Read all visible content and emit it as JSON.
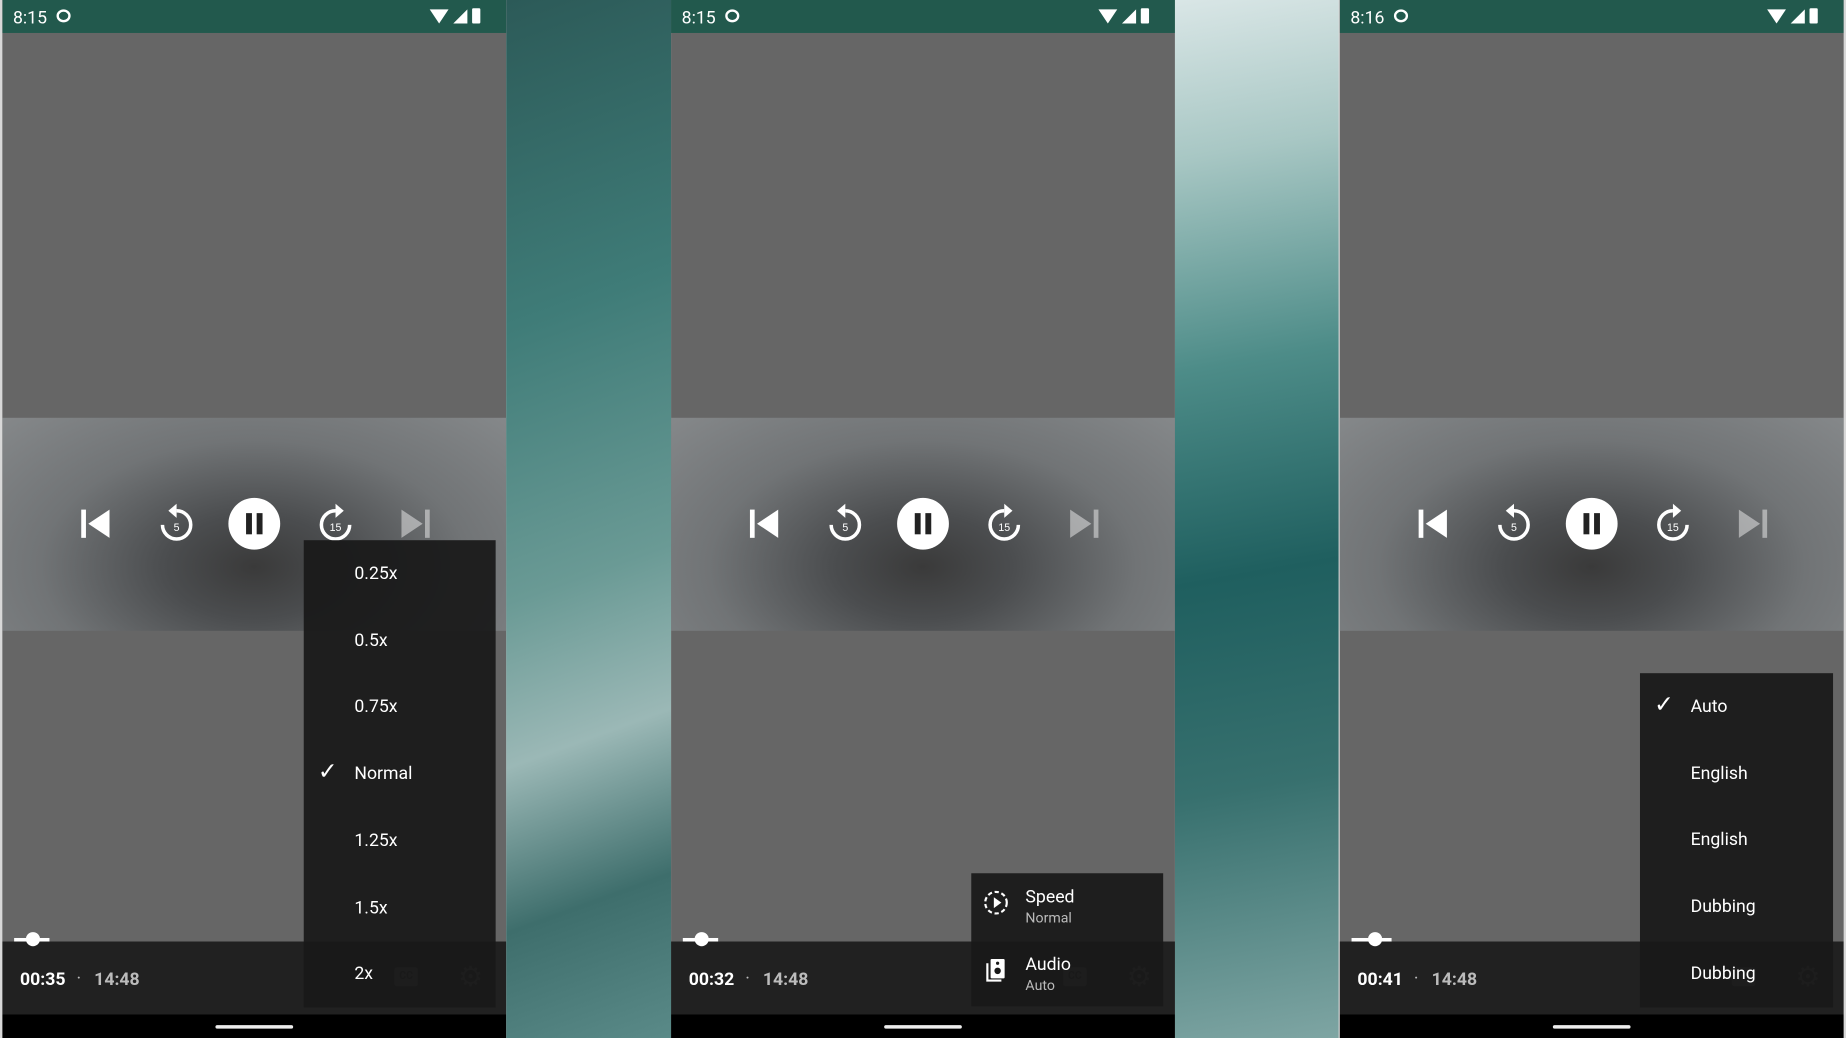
{
  "panels": [
    {
      "status_time": "8:15",
      "position": "00:35",
      "duration": "14:48",
      "progress_fraction": 0.04
    },
    {
      "status_time": "8:15",
      "position": "00:32",
      "duration": "14:48",
      "progress_fraction": 0.04
    },
    {
      "status_time": "8:16",
      "position": "00:41",
      "duration": "14:48",
      "progress_fraction": 0.05
    }
  ],
  "separator": "·",
  "cc_label": "CC",
  "speed_menu": {
    "items": [
      "0.25x",
      "0.5x",
      "0.75x",
      "Normal",
      "1.25x",
      "1.5x",
      "2x"
    ],
    "selected": "Normal"
  },
  "settings_menu": {
    "items": [
      {
        "title": "Speed",
        "subtitle": "Normal",
        "icon": "speed-icon"
      },
      {
        "title": "Audio",
        "subtitle": "Auto",
        "icon": "speaker-icon"
      }
    ]
  },
  "audio_menu": {
    "items": [
      "Auto",
      "English",
      "English",
      "Dubbing",
      "Dubbing"
    ],
    "selected": "Auto"
  },
  "controls": {
    "rewind_seconds": "5",
    "forward_seconds": "15"
  },
  "colors": {
    "status_bar": "#22594d",
    "player_bg": "#666666",
    "bottom_bar": "#212121",
    "menu_bg": "#191919"
  }
}
